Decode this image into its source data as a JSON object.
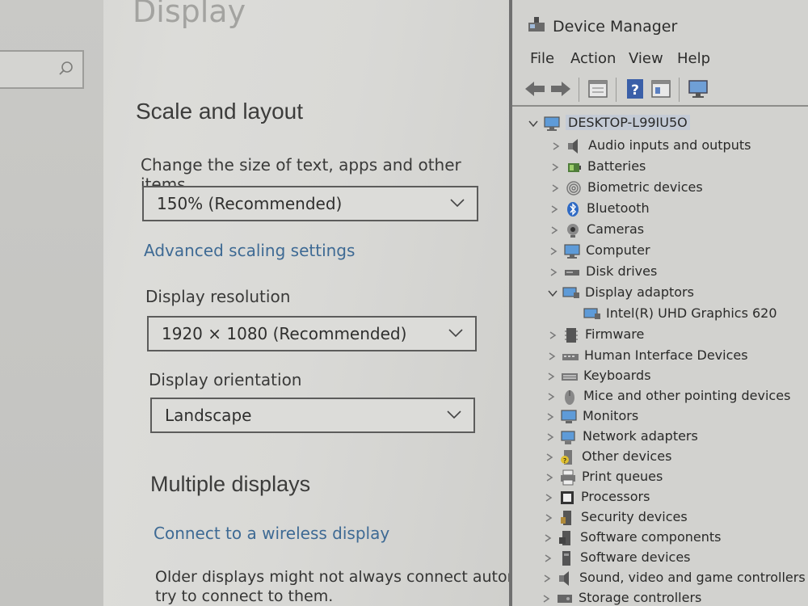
{
  "settings": {
    "page_title": "Display",
    "scale_section": {
      "header": "Scale and layout",
      "size_label": "Change the size of text, apps and other items",
      "size_value": "150% (Recommended)",
      "advanced_link": "Advanced scaling settings",
      "resolution_label": "Display resolution",
      "resolution_value": "1920 × 1080 (Recommended)",
      "orientation_label": "Display orientation",
      "orientation_value": "Landscape"
    },
    "multiple_section": {
      "header": "Multiple displays",
      "wireless_link": "Connect to a wireless display",
      "note_line1": "Older displays might not always connect automati",
      "note_line2": "try to connect to them."
    }
  },
  "device_manager": {
    "title": "Device Manager",
    "menu": [
      "File",
      "Action",
      "View",
      "Help"
    ],
    "root": "DESKTOP-L99IU5O",
    "categories": [
      {
        "label": "Audio inputs and outputs",
        "icon": "speaker-icon",
        "expanded": false
      },
      {
        "label": "Batteries",
        "icon": "battery-icon",
        "expanded": false
      },
      {
        "label": "Biometric devices",
        "icon": "fingerprint-icon",
        "expanded": false
      },
      {
        "label": "Bluetooth",
        "icon": "bluetooth-icon",
        "expanded": false
      },
      {
        "label": "Cameras",
        "icon": "camera-icon",
        "expanded": false
      },
      {
        "label": "Computer",
        "icon": "computer-icon",
        "expanded": false
      },
      {
        "label": "Disk drives",
        "icon": "disk-drive-icon",
        "expanded": false
      },
      {
        "label": "Display adaptors",
        "icon": "display-adapter-icon",
        "expanded": true,
        "children": [
          {
            "label": "Intel(R) UHD Graphics 620",
            "icon": "display-adapter-icon"
          }
        ]
      },
      {
        "label": "Firmware",
        "icon": "firmware-icon",
        "expanded": false
      },
      {
        "label": "Human Interface Devices",
        "icon": "hid-icon",
        "expanded": false
      },
      {
        "label": "Keyboards",
        "icon": "keyboard-icon",
        "expanded": false
      },
      {
        "label": "Mice and other pointing devices",
        "icon": "mouse-icon",
        "expanded": false
      },
      {
        "label": "Monitors",
        "icon": "monitor-icon",
        "expanded": false
      },
      {
        "label": "Network adapters",
        "icon": "network-adapter-icon",
        "expanded": false
      },
      {
        "label": "Other devices",
        "icon": "other-devices-icon",
        "expanded": false
      },
      {
        "label": "Print queues",
        "icon": "printer-icon",
        "expanded": false
      },
      {
        "label": "Processors",
        "icon": "processor-icon",
        "expanded": false
      },
      {
        "label": "Security devices",
        "icon": "security-device-icon",
        "expanded": false
      },
      {
        "label": "Software components",
        "icon": "software-component-icon",
        "expanded": false
      },
      {
        "label": "Software devices",
        "icon": "software-device-icon",
        "expanded": false
      },
      {
        "label": "Sound, video and game controllers",
        "icon": "sound-icon",
        "expanded": false
      },
      {
        "label": "Storage controllers",
        "icon": "storage-controller-icon",
        "expanded": false
      }
    ]
  },
  "colors": {
    "link": "#3e6a94",
    "root_highlight": "#c4cbd6"
  }
}
